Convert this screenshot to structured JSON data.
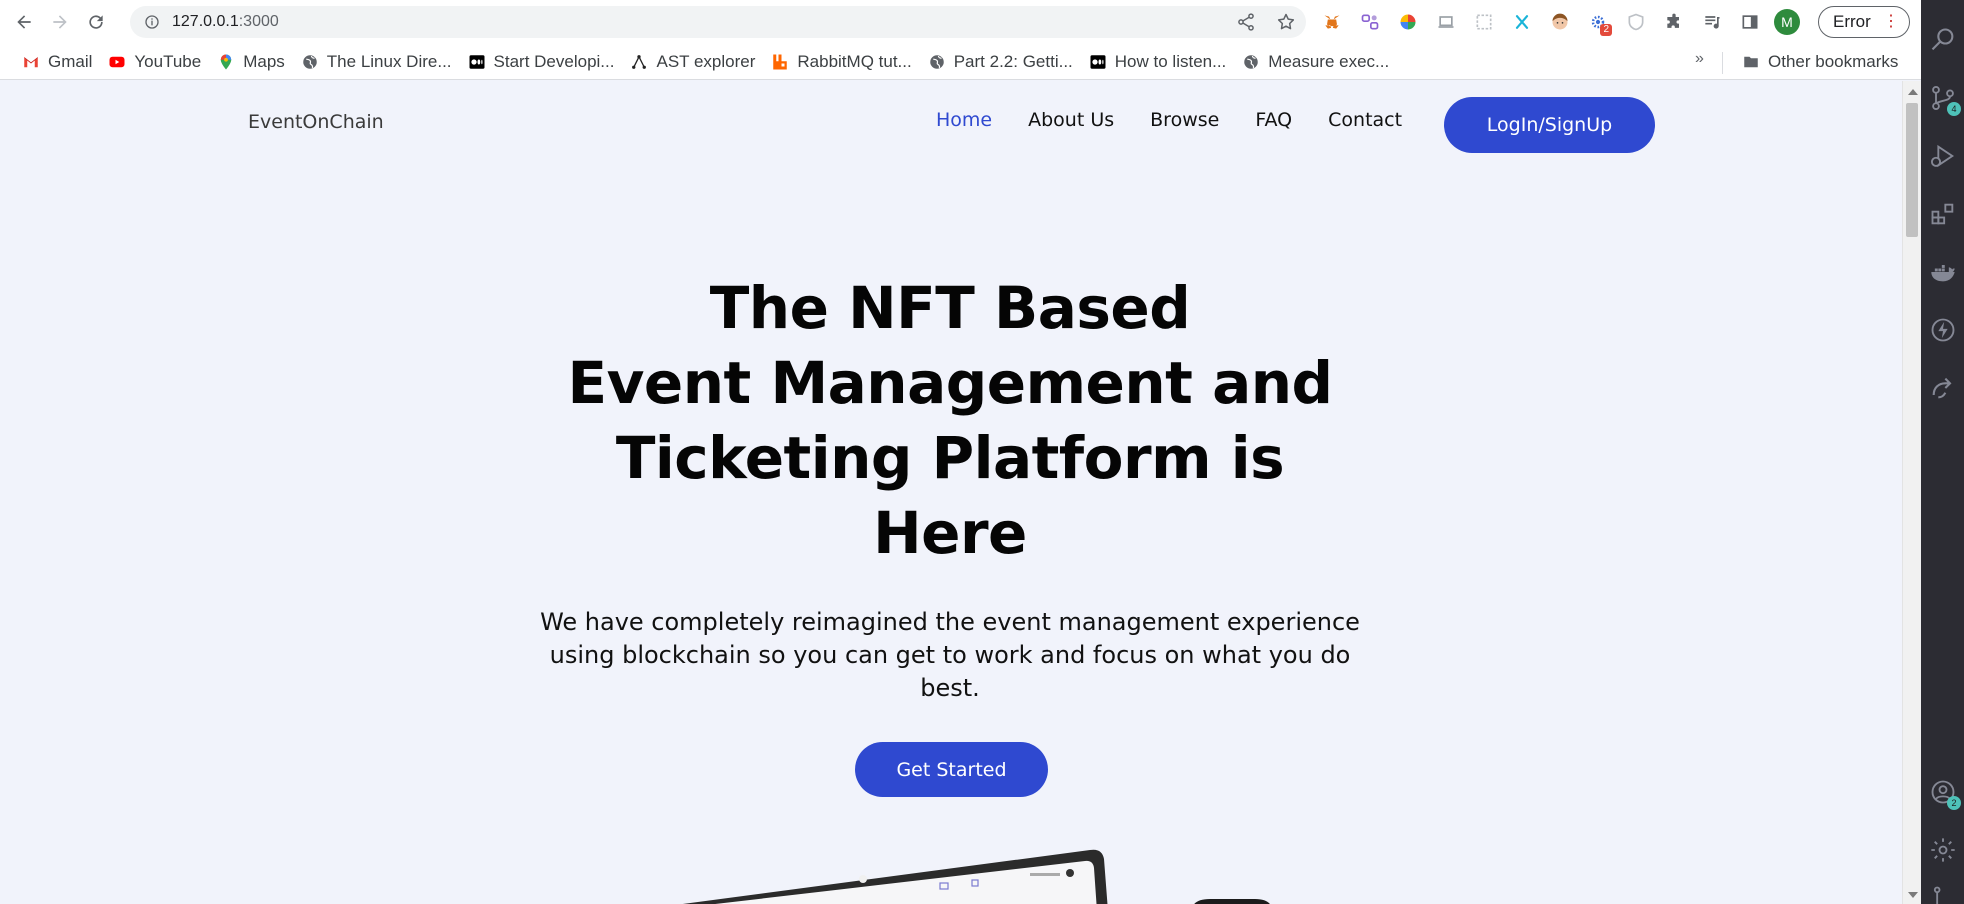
{
  "browser": {
    "url_host": "127.0.0.1",
    "url_port": ":3000",
    "profile_initial": "M",
    "error_chip_label": "Error",
    "extensions": [
      {
        "name": "metamask-icon"
      },
      {
        "name": "ext-purple-icon"
      },
      {
        "name": "color-wheel-icon"
      },
      {
        "name": "laptop-icon"
      },
      {
        "name": "screenshot-icon"
      },
      {
        "name": "x-icon"
      },
      {
        "name": "face-icon"
      },
      {
        "name": "gear-badge-icon",
        "badge": "2"
      },
      {
        "name": "shield-icon"
      },
      {
        "name": "puzzle-icon"
      },
      {
        "name": "media-icon"
      },
      {
        "name": "sidepanel-icon"
      }
    ]
  },
  "bookmarks": {
    "items": [
      {
        "label": "Gmail",
        "icon": "gmail-icon"
      },
      {
        "label": "YouTube",
        "icon": "youtube-icon"
      },
      {
        "label": "Maps",
        "icon": "maps-icon"
      },
      {
        "label": "The Linux Dire...",
        "icon": "globe-icon"
      },
      {
        "label": "Start Developi...",
        "icon": "medium-icon"
      },
      {
        "label": "AST explorer",
        "icon": "ast-icon"
      },
      {
        "label": "RabbitMQ tut...",
        "icon": "rabbitmq-icon"
      },
      {
        "label": "Part 2.2: Getti...",
        "icon": "globe-icon"
      },
      {
        "label": "How to listen...",
        "icon": "medium-icon"
      },
      {
        "label": "Measure exec...",
        "icon": "globe-icon"
      }
    ],
    "more": "»",
    "other_label": "Other bookmarks"
  },
  "site": {
    "brand": "EventOnChain",
    "nav": [
      {
        "label": "Home",
        "active": true
      },
      {
        "label": "About Us",
        "active": false
      },
      {
        "label": "Browse",
        "active": false
      },
      {
        "label": "FAQ",
        "active": false
      },
      {
        "label": "Contact",
        "active": false
      }
    ],
    "login_label": "LogIn/SignUp",
    "hero": {
      "title_lines": [
        "The NFT Based",
        "Event Management and",
        "Ticketing Platform is",
        "Here"
      ],
      "subtitle": "We have completely reimagined the event management experience using blockchain so you can get to work and focus on what you do best.",
      "cta_label": "Get Started"
    }
  },
  "activity_bar": {
    "items": [
      {
        "name": "search-icon"
      },
      {
        "name": "source-control-icon",
        "badge": "4"
      },
      {
        "name": "run-debug-icon"
      },
      {
        "name": "extensions-icon"
      },
      {
        "name": "docker-icon"
      },
      {
        "name": "lightning-icon"
      },
      {
        "name": "remote-icon"
      },
      {
        "name": "account-icon",
        "badge": "2"
      },
      {
        "name": "settings-icon"
      }
    ]
  }
}
